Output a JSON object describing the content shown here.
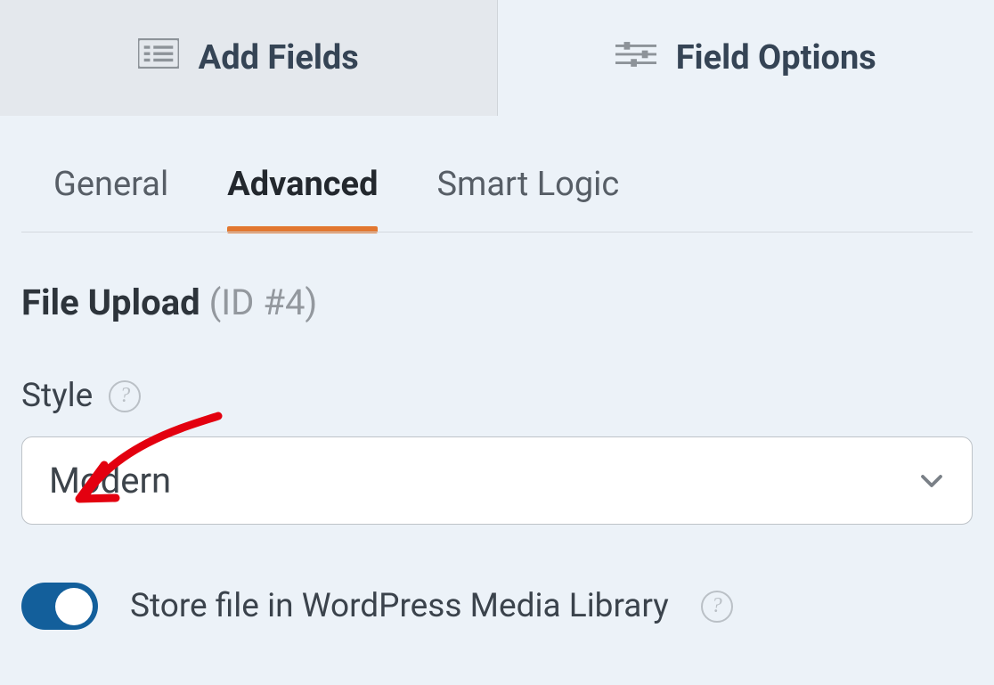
{
  "topTabs": {
    "addFields": "Add Fields",
    "fieldOptions": "Field Options"
  },
  "subTabs": {
    "general": "General",
    "advanced": "Advanced",
    "smartLogic": "Smart Logic"
  },
  "field": {
    "name": "File Upload",
    "idLabel": "(ID #4)"
  },
  "style": {
    "label": "Style",
    "value": "Modern"
  },
  "toggle": {
    "label": "Store file in WordPress Media Library",
    "on": true
  }
}
